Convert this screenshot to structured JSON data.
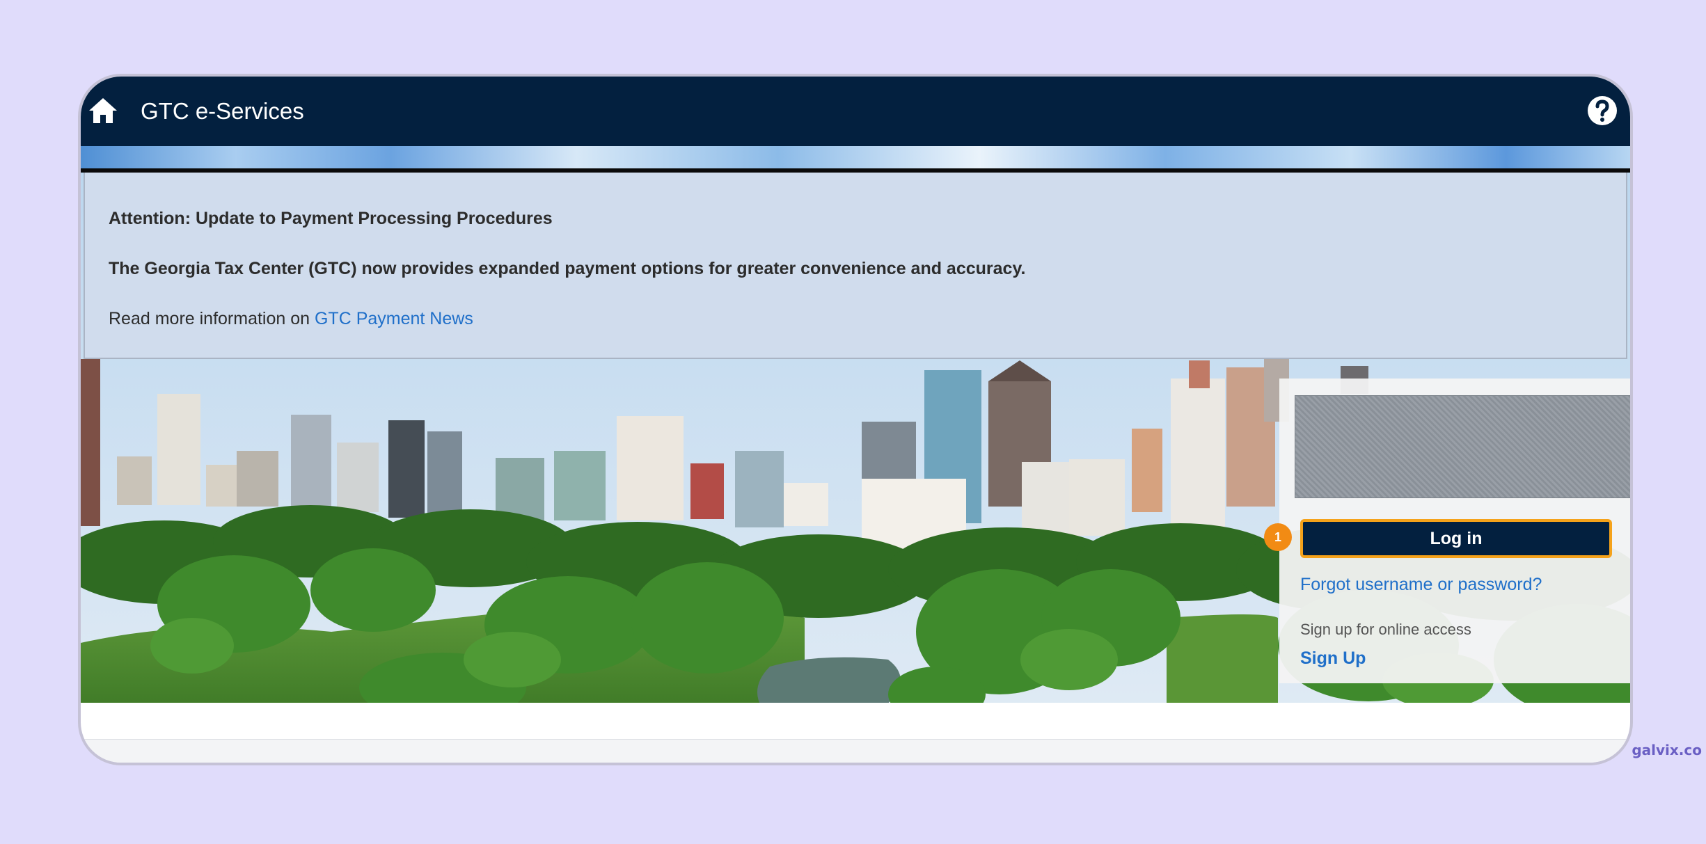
{
  "header": {
    "title": "GTC e-Services",
    "home_icon": "home-icon",
    "help_icon": "help-icon"
  },
  "notice": {
    "title": "Attention: Update to Payment Processing Procedures",
    "body": "The Georgia Tax Center (GTC) now provides expanded payment options for greater convenience and accuracy.",
    "more_prefix": "Read more information on ",
    "more_link": "GTC Payment News"
  },
  "login": {
    "step_number": "1",
    "login_button": "Log in",
    "forgot_link": "Forgot username or password?",
    "signup_label": "Sign up for online access",
    "signup_link": "Sign Up"
  },
  "watermark": "galvix.co",
  "colors": {
    "header_bg": "#03203f",
    "link": "#1f6fc9",
    "highlight": "#f5a21a",
    "page_bg": "#e0dcfb"
  }
}
